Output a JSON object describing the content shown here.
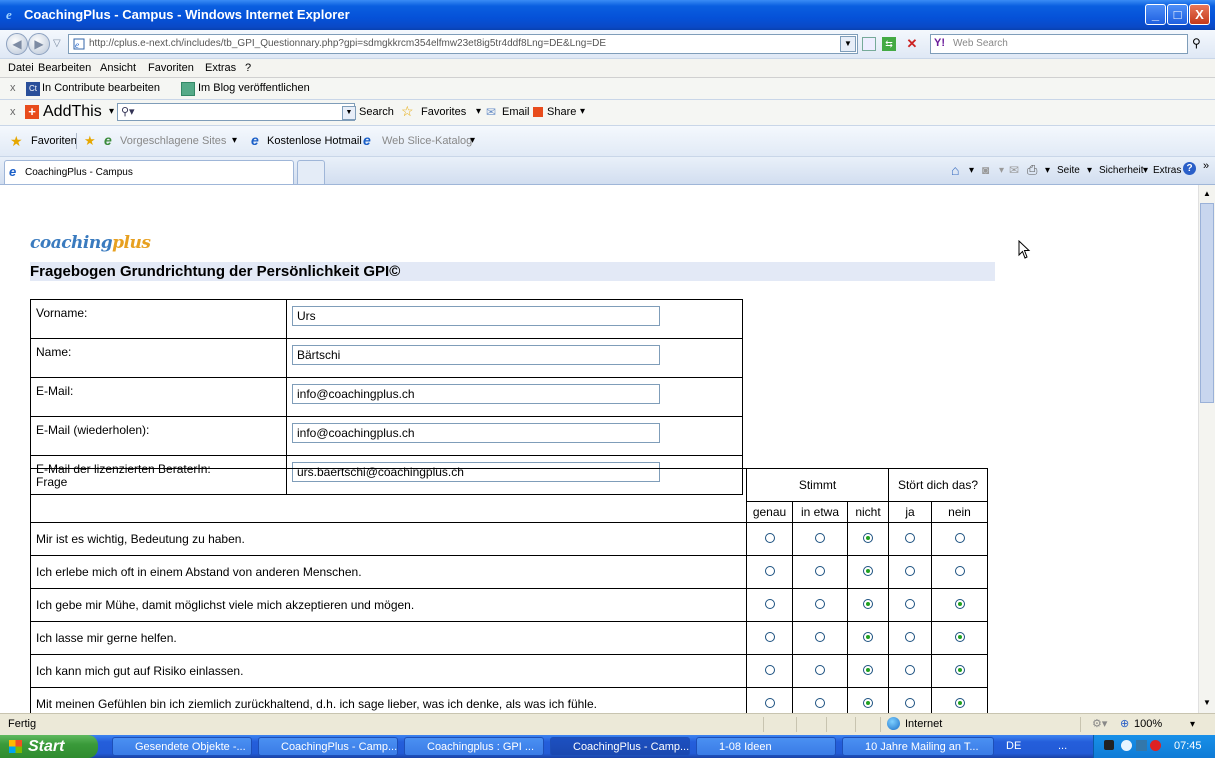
{
  "window": {
    "title": "CoachingPlus - Campus - Windows Internet Explorer",
    "minimize": "_",
    "maximize": "□",
    "close": "X"
  },
  "address": {
    "url": "http://cplus.e-next.ch/includes/tb_GPI_Questionnary.php?gpi=sdmgkkrcm354elfmw23et8ig5tr4ddf8Lng=DE&Lng=DE",
    "search_placeholder": "Web Search"
  },
  "menu": [
    "Datei",
    "Bearbeiten",
    "Ansicht",
    "Favoriten",
    "Extras",
    "?"
  ],
  "contribute": {
    "edit": "In Contribute bearbeiten",
    "blog": "Im Blog veröffentlichen"
  },
  "addthis": {
    "brand": "AddThis",
    "search": "Search",
    "favorites": "Favorites",
    "email": "Email",
    "share": "Share"
  },
  "favbar": {
    "favoriten": "Favoriten",
    "suggested": "Vorgeschlagene Sites",
    "hotmail": "Kostenlose Hotmail",
    "webslice": "Web Slice-Katalog"
  },
  "tabs": {
    "active": "CoachingPlus - Campus",
    "seite": "Seite",
    "sicherheit": "Sicherheit",
    "extras": "Extras"
  },
  "page": {
    "logo_main": "coaching",
    "logo_plus": "plus",
    "title": "Fragebogen Grundrichtung der Persönlichkeit GPI©",
    "form": [
      {
        "label": "Vorname:",
        "value": "Urs"
      },
      {
        "label": "Name:",
        "value": "Bärtschi"
      },
      {
        "label": "E-Mail:",
        "value": "info@coachingplus.ch"
      },
      {
        "label": "E-Mail (wiederholen):",
        "value": "info@coachingplus.ch"
      },
      {
        "label": "E-Mail der lizenzierten BeraterIn:",
        "value": "urs.baertschi@coachingplus.ch"
      }
    ],
    "questions_header": {
      "frage": "Frage",
      "stimmt": "Stimmt",
      "stoert": "Stört dich das?",
      "genau": "genau",
      "in_etwa": "in etwa",
      "nicht": "nicht",
      "ja": "ja",
      "nein": "nein"
    },
    "questions": [
      {
        "text": "Mir ist es wichtig, Bedeutung zu haben.",
        "stimmt": "nicht",
        "stoert": "none"
      },
      {
        "text": "Ich erlebe mich oft in einem Abstand von anderen Menschen.",
        "stimmt": "nicht",
        "stoert": "none"
      },
      {
        "text": "Ich gebe mir Mühe, damit möglichst viele mich akzeptieren und mögen.",
        "stimmt": "nicht",
        "stoert": "nein"
      },
      {
        "text": "Ich lasse mir gerne helfen.",
        "stimmt": "nicht",
        "stoert": "nein"
      },
      {
        "text": "Ich kann mich gut auf Risiko einlassen.",
        "stimmt": "nicht",
        "stoert": "nein"
      },
      {
        "text": "Mit meinen Gefühlen bin ich ziemlich zurückhaltend, d.h. ich sage lieber, was ich denke, als was ich fühle.",
        "stimmt": "nicht",
        "stoert": "nein"
      }
    ]
  },
  "status": {
    "left": "Fertig",
    "zone": "Internet",
    "zoom": "100%"
  },
  "taskbar": {
    "start": "Start",
    "tasks": [
      "Gesendete Objekte -...",
      "CoachingPlus - Camp...",
      "Coachingplus : GPI ...",
      "CoachingPlus - Camp...",
      "1-08 Ideen",
      "10 Jahre Mailing an T..."
    ],
    "lang": "DE",
    "dots": "...",
    "clock": "07:45"
  }
}
